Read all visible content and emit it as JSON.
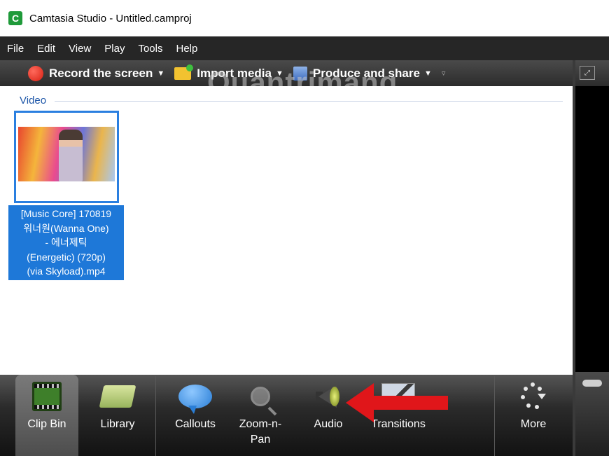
{
  "window": {
    "title": "Camtasia Studio - Untitled.camproj",
    "icon_letter": "C"
  },
  "menu": [
    "File",
    "Edit",
    "View",
    "Play",
    "Tools",
    "Help"
  ],
  "toolbar": {
    "record_label": "Record the screen",
    "import_label": "Import media",
    "produce_label": "Produce and share",
    "overflow": "▿"
  },
  "watermark": "Quantrimang",
  "clip_bin": {
    "group_label": "Video",
    "items": [
      {
        "name": "[Music Core] 170819\n워너원(Wanna One)\n- 에너제틱\n(Energetic) (720p)\n(via Skyload).mp4"
      }
    ]
  },
  "tabs": [
    {
      "label": "Clip Bin",
      "icon": "film-strip-icon",
      "active": true
    },
    {
      "label": "Library",
      "icon": "library-folder-icon"
    },
    {
      "label": "Callouts",
      "icon": "speech-bubble-icon"
    },
    {
      "label": "Zoom-n-\nPan",
      "icon": "magnifier-icon"
    },
    {
      "label": "Audio",
      "icon": "speaker-icon"
    },
    {
      "label": "Transitions",
      "icon": "transition-icon"
    },
    {
      "label": "More",
      "icon": "more-icon"
    }
  ],
  "colors": {
    "selection": "#1e78d8",
    "toolbar": "#2c2c2c",
    "accent_arrow": "#e0161a"
  }
}
